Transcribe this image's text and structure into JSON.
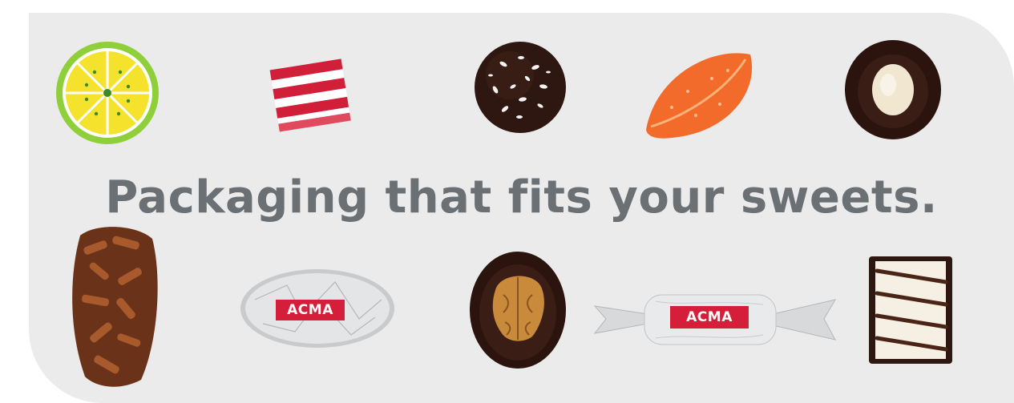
{
  "headline": "Packaging that fits your sweets.",
  "brand_label": "ACMA",
  "colors": {
    "background": "#ebebeb",
    "headline": "#6b7074",
    "brand_red": "#d51f3a",
    "chocolate": "#3a1d14"
  },
  "sweets_top": [
    {
      "name": "lime-candy-slice"
    },
    {
      "name": "striped-hard-candy"
    },
    {
      "name": "coconut-chocolate-truffle"
    },
    {
      "name": "orange-jelly-slice"
    },
    {
      "name": "almond-chocolate-praline"
    }
  ],
  "sweets_bottom": [
    {
      "name": "almond-rocher-bar"
    },
    {
      "name": "foil-wrapped-praline"
    },
    {
      "name": "walnut-chocolate-praline"
    },
    {
      "name": "twist-wrapped-candy"
    },
    {
      "name": "striped-chocolate-bar"
    }
  ]
}
